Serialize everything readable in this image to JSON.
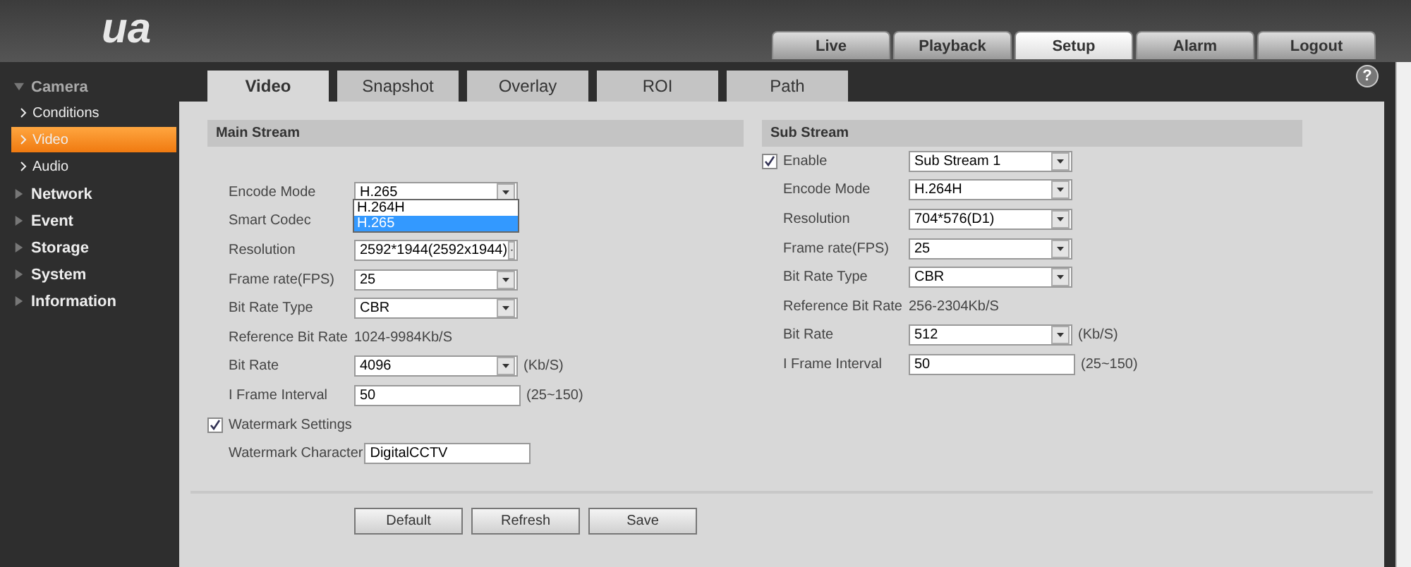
{
  "brand": "ua",
  "top_nav": [
    {
      "label": "Live",
      "selected": false
    },
    {
      "label": "Playback",
      "selected": false
    },
    {
      "label": "Setup",
      "selected": true
    },
    {
      "label": "Alarm",
      "selected": false
    },
    {
      "label": "Logout",
      "selected": false
    }
  ],
  "sidebar": {
    "items": [
      {
        "label": "Camera",
        "expanded": true,
        "children": [
          {
            "label": "Conditions",
            "selected": false
          },
          {
            "label": "Video",
            "selected": true
          },
          {
            "label": "Audio",
            "selected": false
          }
        ]
      },
      {
        "label": "Network",
        "expanded": false
      },
      {
        "label": "Event",
        "expanded": false
      },
      {
        "label": "Storage",
        "expanded": false
      },
      {
        "label": "System",
        "expanded": false
      },
      {
        "label": "Information",
        "expanded": false
      }
    ]
  },
  "tabs": [
    {
      "label": "Video",
      "selected": true
    },
    {
      "label": "Snapshot",
      "selected": false
    },
    {
      "label": "Overlay",
      "selected": false
    },
    {
      "label": "ROI",
      "selected": false
    },
    {
      "label": "Path",
      "selected": false
    }
  ],
  "help": "?",
  "main_stream": {
    "title": "Main Stream",
    "rows": [
      {
        "kind": "select",
        "label": "Encode Mode",
        "value": "H.265",
        "open": true,
        "options": [
          {
            "label": "H.264H",
            "selected": false
          },
          {
            "label": "H.265",
            "selected": true
          }
        ]
      },
      {
        "kind": "label",
        "label": "Smart Codec"
      },
      {
        "kind": "select",
        "label": "Resolution",
        "value": "2592*1944(2592x1944)"
      },
      {
        "kind": "select",
        "label": "Frame rate(FPS)",
        "value": "25"
      },
      {
        "kind": "select",
        "label": "Bit Rate Type",
        "value": "CBR"
      },
      {
        "kind": "text",
        "label": "Reference Bit Rate",
        "value": "1024-9984Kb/S"
      },
      {
        "kind": "select",
        "label": "Bit Rate",
        "value": "4096",
        "unit": "(Kb/S)"
      },
      {
        "kind": "input",
        "label": "I Frame Interval",
        "value": "50",
        "unit": "(25~150)"
      },
      {
        "kind": "check",
        "label": "Watermark Settings",
        "checked": true
      },
      {
        "kind": "input",
        "label": "Watermark Character",
        "value": "DigitalCCTV"
      }
    ]
  },
  "sub_stream": {
    "title": "Sub Stream",
    "rows": [
      {
        "kind": "checkselect",
        "label": "Enable",
        "checked": true,
        "value": "Sub Stream 1"
      },
      {
        "kind": "select",
        "label": "Encode Mode",
        "value": "H.264H"
      },
      {
        "kind": "select",
        "label": "Resolution",
        "value": "704*576(D1)"
      },
      {
        "kind": "select",
        "label": "Frame rate(FPS)",
        "value": "25"
      },
      {
        "kind": "select",
        "label": "Bit Rate Type",
        "value": "CBR"
      },
      {
        "kind": "text",
        "label": "Reference Bit Rate",
        "value": "256-2304Kb/S"
      },
      {
        "kind": "select",
        "label": "Bit Rate",
        "value": "512",
        "unit": "(Kb/S)"
      },
      {
        "kind": "input",
        "label": "I Frame Interval",
        "value": "50",
        "unit": "(25~150)"
      }
    ]
  },
  "buttons": [
    "Default",
    "Refresh",
    "Save"
  ]
}
